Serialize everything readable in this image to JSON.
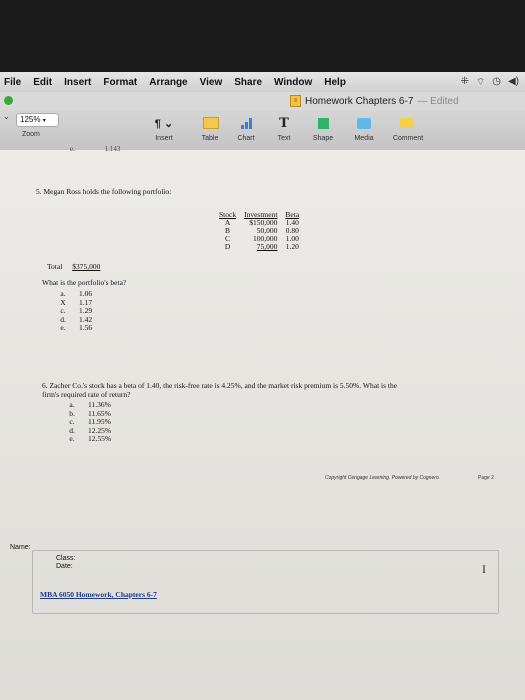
{
  "menubar": {
    "items": [
      "File",
      "Edit",
      "Insert",
      "Format",
      "Arrange",
      "View",
      "Share",
      "Window",
      "Help"
    ]
  },
  "window": {
    "doc_title": "Homework Chapters 6-7",
    "edited": "— Edited"
  },
  "toolbar": {
    "zoom_value": "125%",
    "zoom_label": "Zoom",
    "buttons": [
      {
        "label": "Insert"
      },
      {
        "label": "Table"
      },
      {
        "label": "Chart"
      },
      {
        "label": "Text"
      },
      {
        "label": "Shape"
      },
      {
        "label": "Media"
      },
      {
        "label": "Comment"
      }
    ]
  },
  "document": {
    "prev_letter": "e.",
    "prev_value": "1.143",
    "q5": {
      "text": "5. Megan Ross holds the following portfolio:",
      "headers": [
        "Stock",
        "Investment",
        "Beta"
      ],
      "rows": [
        [
          "A",
          "$150,000",
          "1.40"
        ],
        [
          "B",
          "50,000",
          "0.80"
        ],
        [
          "C",
          "100,000",
          "1.00"
        ],
        [
          "D",
          "75,000",
          "1.20"
        ]
      ],
      "total_label": "Total",
      "total_value": "$375,000",
      "question": "What is the portfolio's beta?",
      "options": [
        [
          "a.",
          "1.06"
        ],
        [
          "X",
          "1.17"
        ],
        [
          "c.",
          "1.29"
        ],
        [
          "d.",
          "1.42"
        ],
        [
          "e.",
          "1.56"
        ]
      ]
    },
    "q6": {
      "line1": "6. Zacher Co.'s stock has a beta of 1.40, the risk-free rate is 4.25%, and the market risk premium is 5.50%. What is the",
      "line2": "firm's required rate of return?",
      "options": [
        [
          "a.",
          "11.36%"
        ],
        [
          "b.",
          "11.65%"
        ],
        [
          "c.",
          "11.95%"
        ],
        [
          "d.",
          "12.25%"
        ],
        [
          "e.",
          "12.55%"
        ]
      ]
    },
    "copyright": "Copyright Cengage Learning. Powered by Cognero.",
    "page_number": "Page 2",
    "footer": {
      "name_label": "Name:",
      "class_label": "Class:",
      "date_label": "Date:",
      "course": "MBA 6050 Homework, Chapters 6-7"
    }
  }
}
